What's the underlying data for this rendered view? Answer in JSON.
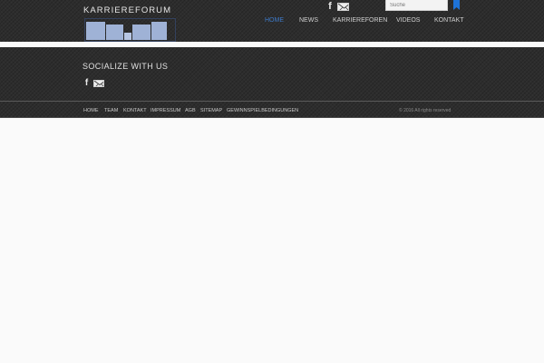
{
  "header": {
    "logo_text": "KARRIEREFORUM",
    "search_placeholder": "Suche",
    "nav": [
      {
        "label": "HOME",
        "active": true
      },
      {
        "label": "NEWS"
      },
      {
        "label": "KARRIEREFOREN"
      },
      {
        "label": "VIDEOS"
      },
      {
        "label": "KONTAKT"
      }
    ],
    "social": [
      {
        "label": "f",
        "icon": "facebook-icon"
      },
      {
        "icon": "mail-icon"
      }
    ]
  },
  "footer": {
    "social_title": "SOCIALIZE WITH US",
    "social": [
      {
        "label": "f",
        "icon": "facebook-icon"
      },
      {
        "icon": "mail-icon"
      }
    ],
    "links": [
      "HOME",
      "TEAM",
      "KONTAKT",
      "IMPRESSUM",
      "AGB",
      "SITEMAP",
      "GEWINNSPIELBEDINGUNGEN"
    ],
    "copyright": "© 2016 All rights reserved"
  },
  "colors": {
    "active_nav": "#3d79c7",
    "bookmark": "#1e73d8",
    "dark_band": "#2d2d2d",
    "page_bg": "#fafafa"
  }
}
